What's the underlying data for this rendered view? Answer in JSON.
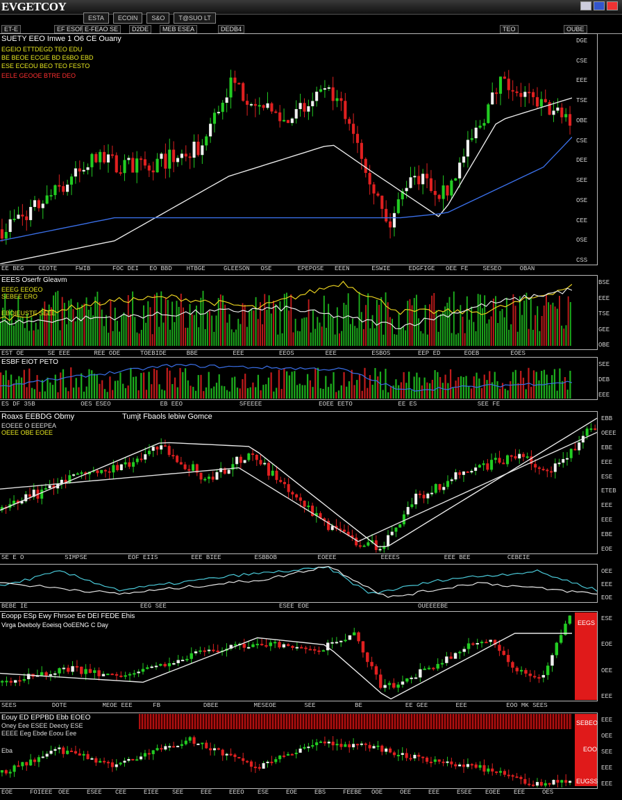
{
  "app": {
    "title": "EVGETCOY"
  },
  "tabs": [
    "ESTA",
    "ECOIN",
    "S&O",
    "T@SUO LT"
  ],
  "toolbar": [
    {
      "label": "ET-E"
    },
    {
      "label": "EF ESOR"
    },
    {
      "label": "E-FEAO SE"
    },
    {
      "label": "D2DE"
    },
    {
      "label": "MEB ESEA"
    },
    {
      "label": "DEDB4"
    },
    {
      "label": "TEO"
    },
    {
      "label": "OUBE"
    }
  ],
  "panel1": {
    "title": "SUETY EEO Imwe 1 O6 CE Ouany",
    "legend_yellow": [
      "EGEIO  ETTDEGD  TEO  EDU",
      "BE BEOE  ECGIE BD  E6BO  EBD",
      "ESE  ECEOU  BEO  TEO  FESTO"
    ],
    "legend_red": "EELE GEOOE  BTRE  DEO",
    "y_ticks": [
      "DGE",
      "CSE",
      "EEE",
      "TSE",
      "OBE",
      "CSE",
      "DEE",
      "SEE",
      "OSE",
      "CEE",
      "OSE",
      "CSS"
    ],
    "x_ticks": [
      "EE BEG",
      "CEOTE",
      "FWIB",
      "FOC DEI",
      "EO BBD",
      "HTBGE",
      "GLEESON",
      "OSE",
      "EPEPOSE",
      "EEEN",
      "ESWIE",
      "EDGFIGE",
      "OEE FE",
      "SESEO",
      "OBAN"
    ]
  },
  "panel2": {
    "title": "EEES Oserfr Gleavm",
    "legend": [
      "EEEG EEOEO",
      "SEBEE  ERO",
      "EBOIEUSTE  SEEE"
    ],
    "y_ticks": [
      "BSE",
      "EEE",
      "TSE",
      "GEE",
      "OBE"
    ],
    "x_ticks": [
      "EST OE",
      "SE EEE",
      "REE ODE",
      "TOEBIDE",
      "BBE",
      "EEE",
      "EEOS",
      "EEE",
      "ESBOS",
      "EEP ED",
      "EOEB",
      "EOES"
    ]
  },
  "panel3": {
    "title": "ESBF EIOT PETO",
    "y_ticks": [
      "SEE",
      "DEB",
      "EEE"
    ],
    "x_ticks": [
      "ES DF 35B",
      "OES ESEO",
      "EB EEO",
      "SFEEEE",
      "EOEE EETO",
      "EE ES",
      "SEE FE"
    ]
  },
  "panel4": {
    "title": "Roaxs EEBDG Obmy",
    "subtitle": "Tumjt Fbaols lebiw Gomce",
    "legend": [
      "EOEEE O EEEPEA",
      "OEEE OBE EOEE"
    ],
    "y_ticks": [
      "EBB",
      "OEEE",
      "EBE",
      "EEE",
      "ESE",
      "ETEB",
      "EEE",
      "EEE",
      "EBE",
      "EOE"
    ],
    "x_ticks": [
      "SE E O",
      "SIMPSE",
      "EOF EIIS",
      "EEE BIEE",
      "ESBBOB",
      "EOEEE",
      "EEEES",
      "EEE BEE",
      "CEBEIE"
    ]
  },
  "panel5": {
    "y_ticks": [
      "OEE",
      "EEE",
      "EOE"
    ],
    "x_ticks": [
      "BEBE IE",
      "EEG SEE",
      "ESEE EOE",
      "OUEEEEBE"
    ]
  },
  "panel6": {
    "title": "Eoopp ESp Ewy Fhrsoe Ee DEI FEDE  Ehis",
    "subtitle": "Virga Deeboly Eoeisq OoEENG C Day",
    "y_ticks": [
      "ESE",
      "EOE",
      "OEE",
      "EEE"
    ],
    "x_ticks": [
      "SEES",
      "DOTE",
      "MEOE EEE",
      "FB",
      "DBEE",
      "MESEOE",
      "SEE",
      "BE",
      "EE GEE",
      "EEE",
      "EOO MK SEES"
    ],
    "badge": "EEGS"
  },
  "panel7": {
    "title": "Eouy ED EPPBD Ebb EOEO",
    "legend": [
      "Oney Eee ESEE Deecty ESE",
      "EEEE Eeg Ebde Eoou Eee"
    ],
    "left_label": "Eba",
    "badges": [
      "SEBEO",
      "EOO",
      "EUGSS"
    ],
    "y_ticks": [
      "EEE",
      "OEE",
      "SEE",
      "EEE",
      "EEE"
    ],
    "x_ticks": [
      "EOE",
      "FOIEEE",
      "OEE",
      "ESEE",
      "CEE",
      "EIEE",
      "SEE",
      "EEE",
      "EEEO",
      "ESE",
      "EOE",
      "EBS",
      "FEEBE",
      "OOE",
      "OEE",
      "EEE",
      "ESEE",
      "EOEE",
      "EEE",
      "OES"
    ]
  },
  "colors": {
    "up": "#22cc22",
    "down": "#e02020",
    "ma_white": "#e8e8e8",
    "ma_blue": "#3a6fe8",
    "ma_yellow": "#e8d020",
    "background": "#000000"
  }
}
